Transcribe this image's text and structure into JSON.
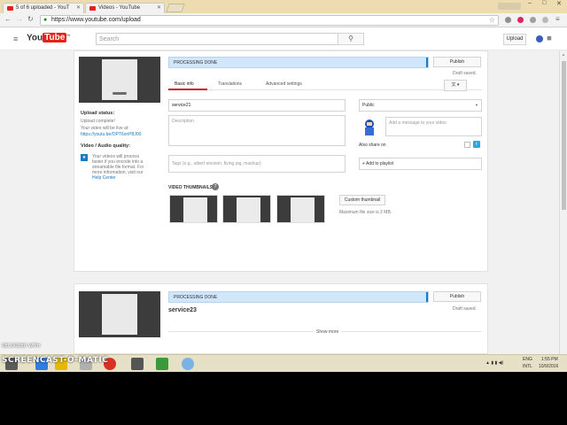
{
  "tabs": [
    {
      "label": "5 of 6 uploaded - YouT"
    },
    {
      "label": "Videos - YouTube"
    }
  ],
  "window": {
    "minimize": "–",
    "maximize": "□",
    "close": "✕"
  },
  "address": {
    "url": "https://www.youtube.com/upload"
  },
  "nav": {
    "back": "←",
    "forward": "→",
    "reload": "↻",
    "menu": "≡",
    "star": "☆",
    "lock": "🔒"
  },
  "youtube": {
    "logo_you": "You",
    "logo_tube": "Tube",
    "logo_region": "IN",
    "hamburger": "≡",
    "search_placeholder": "Search",
    "search_icon": "⚲",
    "upload_label": "Upload",
    "notification_icon": "🔔"
  },
  "upload1": {
    "status_text": "PROCESSING DONE",
    "publish_label": "Publish",
    "draft_saved": "Draft saved.",
    "upload_status_heading": "Upload status:",
    "upload_complete": "Upload complete!",
    "live_at": "Your video will be live at:",
    "video_link": "https://youtu.be/OPT6onP8J00",
    "quality_heading": "Video / Audio quality:",
    "quality_text": "Your videos will process faster if you encode into a streamable file format. For more information, visit our",
    "help_center": "Help Center",
    "tabs": [
      "Basic info",
      "Translations",
      "Advanced settings"
    ],
    "title_value": "service21",
    "description_placeholder": "Description",
    "tags_placeholder": "Tags (e.g., albert einstein, flying pig, mashup)",
    "privacy": "Public",
    "message_placeholder": "Add a message to your video",
    "also_share": "Also share on",
    "twitter_icon": "t",
    "add_to_playlist": "+ Add to playlist",
    "thumbnails_heading": "VIDEO THUMBNAILS",
    "custom_thumbnail": "Custom thumbnail",
    "max_size": "Maximum file size is 2 MB."
  },
  "upload2": {
    "status_text": "PROCESSING DONE",
    "publish_label": "Publish",
    "draft_saved": "Draft saved.",
    "title": "service23",
    "show_more": "Show more"
  },
  "watermark": {
    "line1": "RECORDED WITH",
    "line2": "SCREENCAST-O-MATIC"
  },
  "tray": {
    "language": "ENG",
    "region": "INTL",
    "time": "1:55 PM",
    "date": "10/9/2016"
  }
}
